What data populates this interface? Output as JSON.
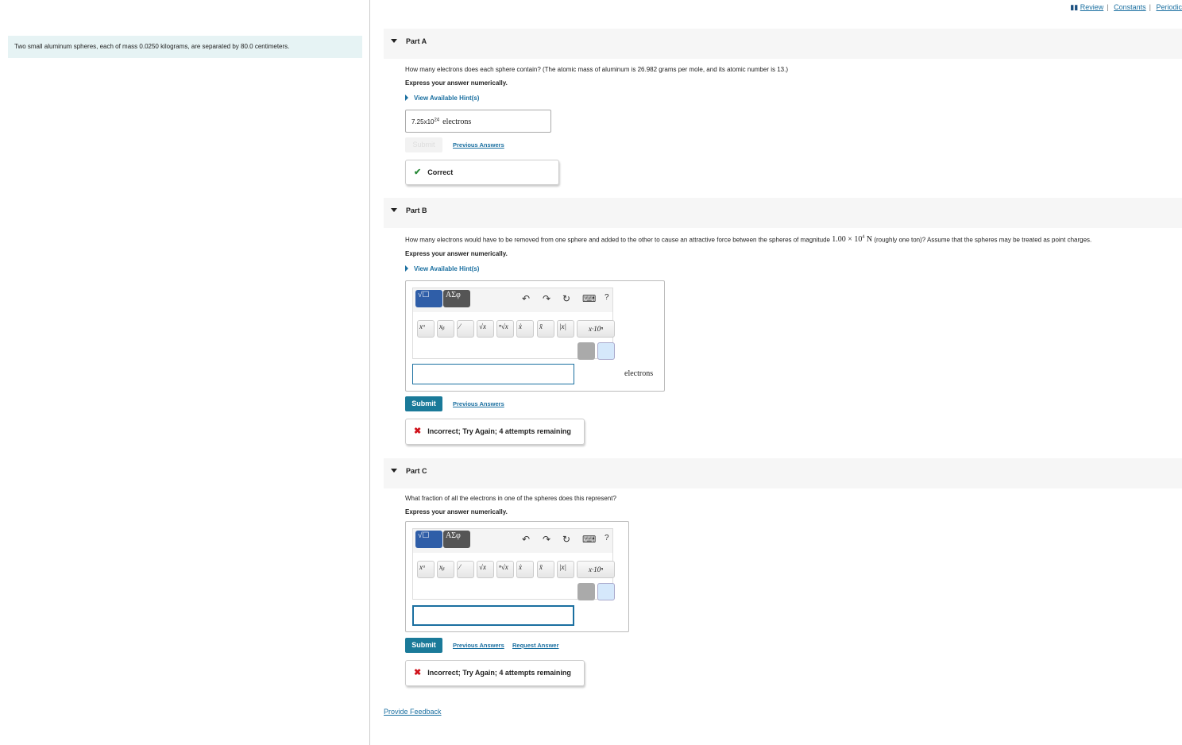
{
  "toplinks": [
    "Review",
    "Constants",
    "Periodic"
  ],
  "statement": "Two small aluminum spheres, each of mass 0.0250 kilograms, are separated by 80.0 centimeters.",
  "express": "Express your answer numerically.",
  "hint": "View Available Hint(s)",
  "submit": "Submit",
  "prev": "Previous Answers",
  "request": "Request Answer",
  "toolbar": {
    "templates": "√☐",
    "greek": "ΑΣφ",
    "undo": "↶",
    "redo": "↷",
    "reset": "↻",
    "keyboard": "⌨",
    "help": "?",
    "keys": [
      "xᵃ",
      "xᵦ",
      "⁄",
      "√x",
      "ⁿ√x",
      "ẋ",
      "x̄",
      "|x|",
      "x·10ⁿ"
    ]
  },
  "partA": {
    "title": "Part A",
    "question": "How many electrons does each sphere contain? (The atomic mass of aluminum is 26.982 grams per mole, and its atomic number is 13.)",
    "answer_mantissa": "7.25x10",
    "answer_exp": "24",
    "unit": "electrons",
    "feedback": "Correct",
    "status_color": "#2a8a3a"
  },
  "partB": {
    "title": "Part B",
    "question_pre": "How many electrons would have to be removed from one sphere and added to the other to cause an attractive force between the spheres of magnitude ",
    "quantity": "1.00 × 10",
    "q_exp": "4",
    "q_unit": " N",
    "question_post": " (roughly one ton)? Assume that the spheres may be treated as point charges.",
    "unit": "electrons",
    "input": "",
    "feedback": "Incorrect; Try Again; 4 attempts remaining",
    "status_color": "#d0121b"
  },
  "partC": {
    "title": "Part C",
    "question": "What fraction of all the electrons in one of the spheres does this represent?",
    "input": "",
    "feedback": "Incorrect; Try Again; 4 attempts remaining"
  },
  "feedback_link": "Provide Feedback"
}
